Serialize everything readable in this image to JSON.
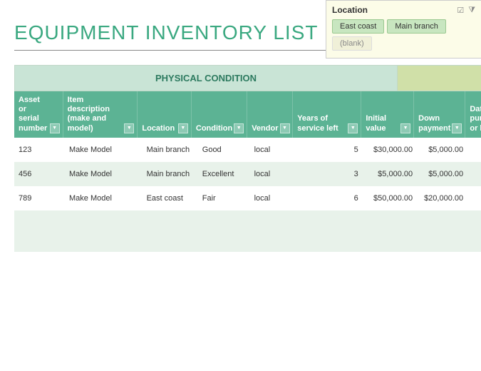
{
  "title": "EQUIPMENT INVENTORY LIST",
  "slicer": {
    "title": "Location",
    "items": [
      "East coast",
      "Main branch",
      "(blank)"
    ]
  },
  "sections": {
    "physical": "PHYSICAL CONDITION",
    "finance": ""
  },
  "headers": {
    "asset": "Asset or serial number",
    "desc": "Item description (make and model)",
    "loc": "Location",
    "cond": "Condition",
    "vend": "Vendor",
    "years": "Years of service left",
    "init": "Initial value",
    "down": "Down payment",
    "date": "Date purchased or leased"
  },
  "rows": [
    {
      "asset": "123",
      "desc": "Make Model",
      "loc": "Main branch",
      "cond": "Good",
      "vend": "local",
      "years": "5",
      "init": "$30,000.00",
      "down": "$5,000.00"
    },
    {
      "asset": "456",
      "desc": "Make Model",
      "loc": "Main branch",
      "cond": "Excellent",
      "vend": "local",
      "years": "3",
      "init": "$5,000.00",
      "down": "$5,000.00"
    },
    {
      "asset": "789",
      "desc": "Make Model",
      "loc": "East coast",
      "cond": "Fair",
      "vend": "local",
      "years": "6",
      "init": "$50,000.00",
      "down": "$20,000.00"
    }
  ]
}
